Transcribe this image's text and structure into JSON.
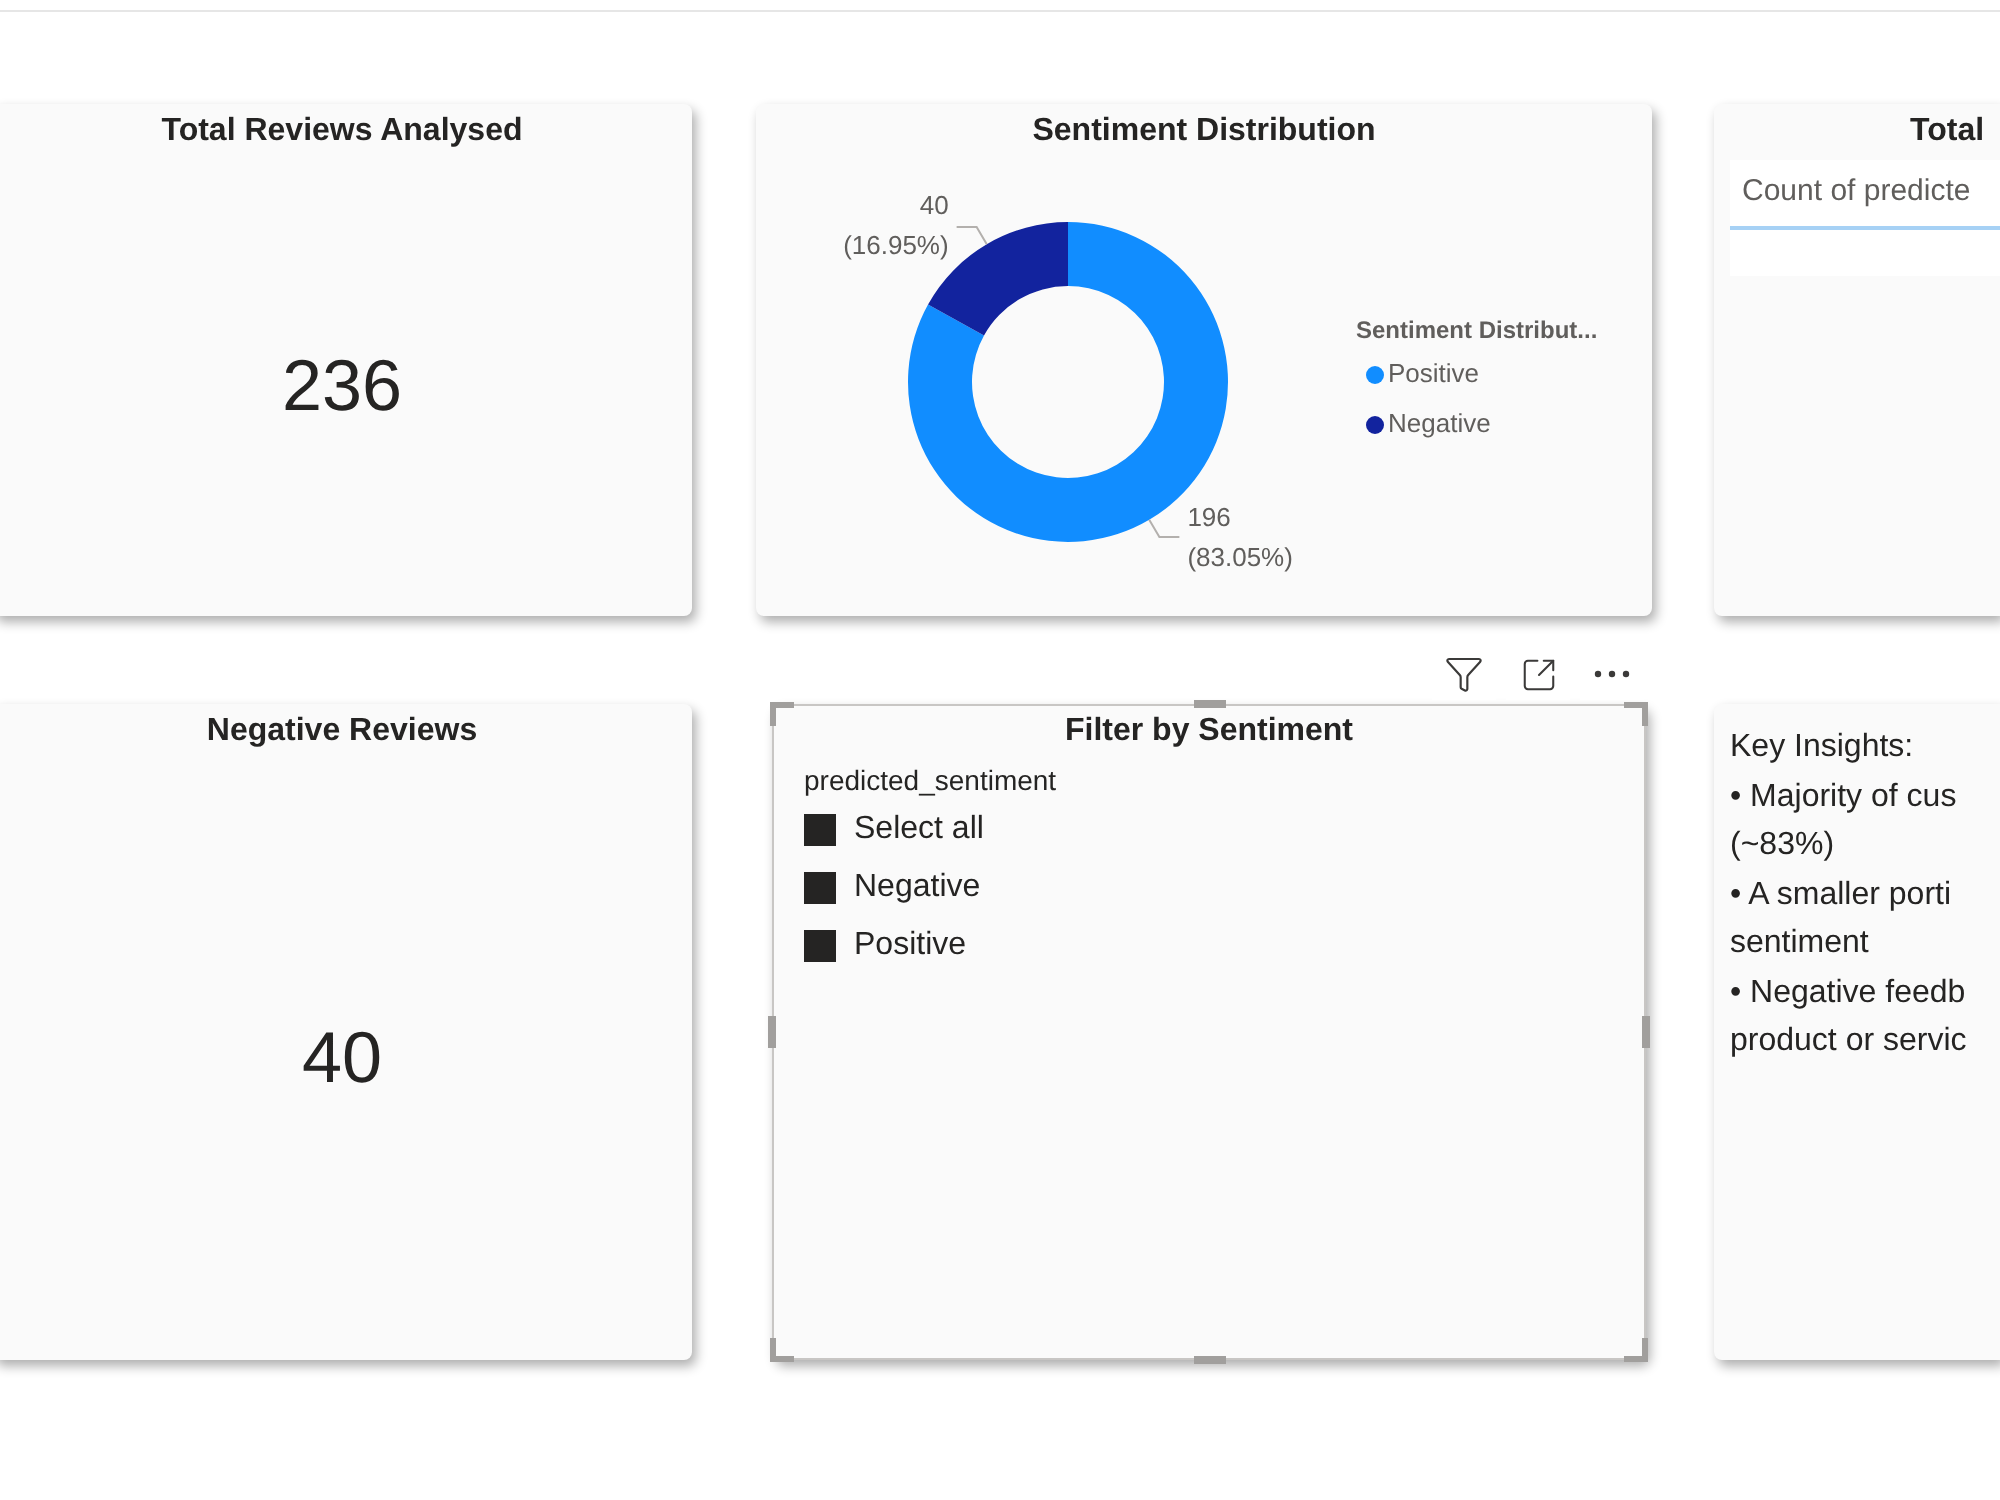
{
  "rows": [
    {
      "visuals": [
        {
          "kind": "kpi",
          "title": "Total Reviews Analysed",
          "value": "236"
        },
        {
          "kind": "donut",
          "title": "Sentiment Distribution",
          "chart_data": {
            "type": "donut",
            "categories": [
              "Positive",
              "Negative"
            ],
            "values": [
              196,
              40
            ],
            "value_labels": [
              "196 (83.05%)",
              "40 (16.95%)"
            ],
            "legend": {
              "title": "Sentiment Distribut...",
              "items": [
                {
                  "color": "#118dff"
                },
                {
                  "color": "#12239e"
                }
              ]
            }
          }
        },
        {
          "kind": "table",
          "title": "Total",
          "columns": [
            "Count of predicte"
          ]
        }
      ]
    },
    {
      "visuals": [
        {
          "kind": "kpi",
          "title": "Negative Reviews",
          "value": "40"
        },
        {
          "kind": "slicer",
          "selected": true,
          "title": "Filter by Sentiment",
          "field": "predicted_sentiment",
          "items": [
            {
              "label": "Select all",
              "checked": true
            },
            {
              "label": "Negative",
              "checked": true
            },
            {
              "label": "Positive",
              "checked": true
            }
          ]
        },
        {
          "kind": "textbox",
          "lines": [
            "Key Insights:",
            "• Majority of cus",
            "(~83%)",
            "• A smaller porti",
            "sentiment",
            "• Negative feedb",
            "product or servic"
          ]
        }
      ]
    }
  ]
}
